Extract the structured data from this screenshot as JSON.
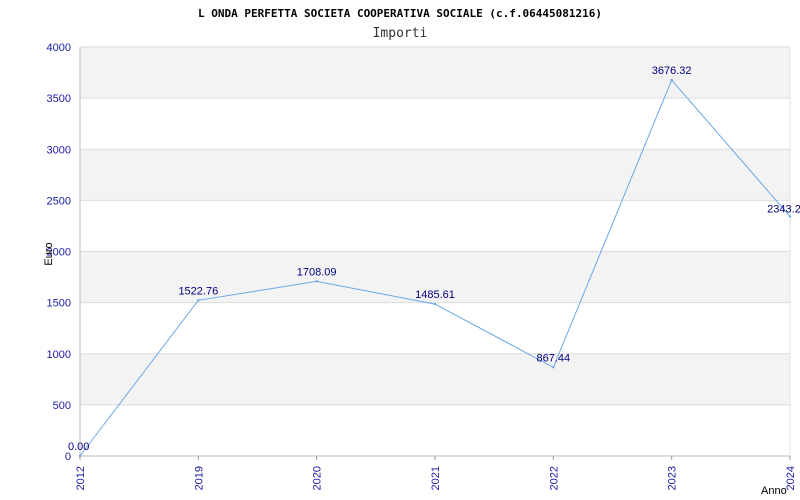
{
  "chart_data": {
    "type": "line",
    "title": "L ONDA PERFETTA SOCIETA COOPERATIVA SOCIALE (c.f.06445081216)",
    "subtitle": "Importi",
    "xlabel": "Anno",
    "ylabel": "Euro",
    "categories": [
      "2012",
      "2019",
      "2020",
      "2021",
      "2022",
      "2023",
      "2024"
    ],
    "values": [
      0.0,
      1522.76,
      1708.09,
      1485.61,
      867.44,
      3676.32,
      2343.2
    ],
    "data_labels": [
      "0.00",
      "1522.76",
      "1708.09",
      "1485.61",
      "867.44",
      "3676.32",
      "2343.2"
    ],
    "y_ticks": [
      "0",
      "500",
      "1000",
      "1500",
      "2000",
      "2500",
      "3000",
      "3500",
      "4000"
    ],
    "ylim": [
      0,
      4000
    ],
    "grid": true,
    "colors": {
      "line": "#6aa8e8",
      "band": "#f3f3f3",
      "tick_text": "#1a1aa6",
      "label_text": "#000080"
    }
  }
}
